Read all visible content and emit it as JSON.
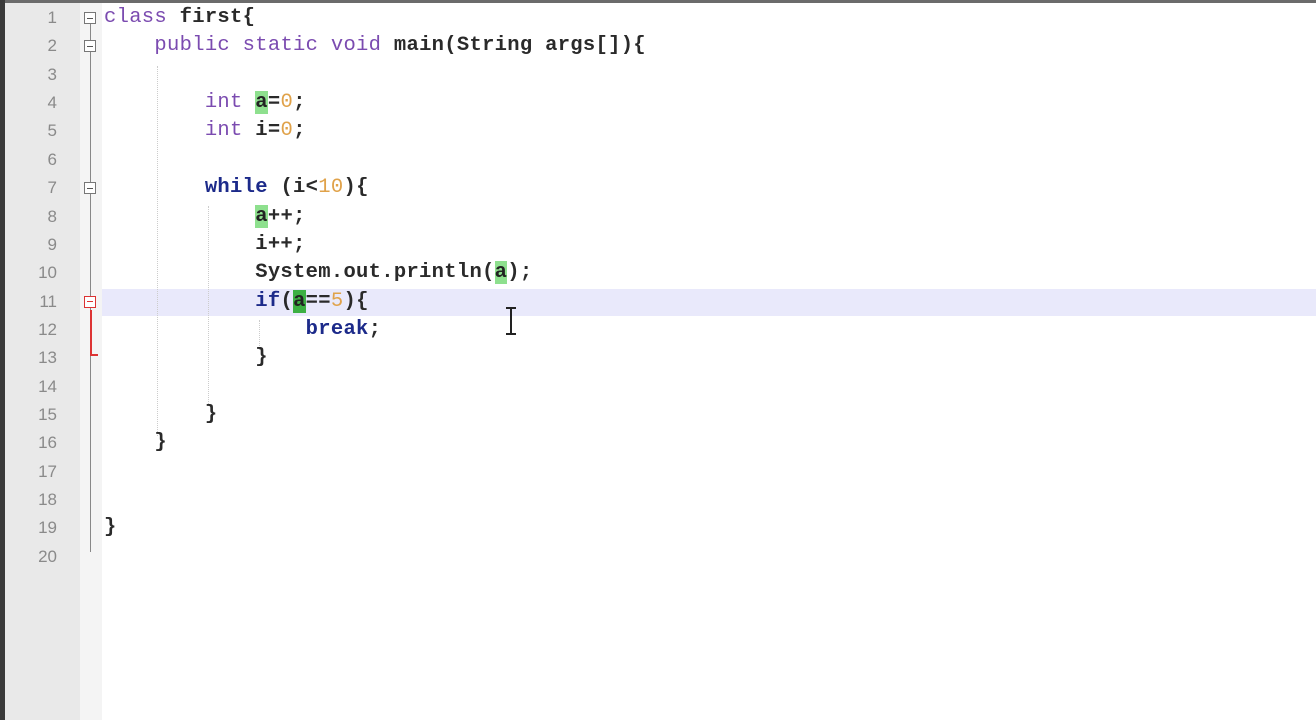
{
  "editor": {
    "current_line": 11,
    "lines": [
      {
        "n": "1",
        "tokens": [
          [
            "kw",
            "class"
          ],
          [
            "plain",
            " first{"
          ]
        ],
        "fold": "open"
      },
      {
        "n": "2",
        "tokens": [
          [
            "plain",
            "    "
          ],
          [
            "kw",
            "public static void"
          ],
          [
            "plain",
            " main(String args[]){"
          ]
        ],
        "fold": "open"
      },
      {
        "n": "3",
        "tokens": []
      },
      {
        "n": "4",
        "tokens": [
          [
            "plain",
            "        "
          ],
          [
            "kw",
            "int"
          ],
          [
            "plain",
            " "
          ],
          [
            "hl",
            "a"
          ],
          [
            "plain",
            "="
          ],
          [
            "num",
            "0"
          ],
          [
            "plain",
            ";"
          ]
        ]
      },
      {
        "n": "5",
        "tokens": [
          [
            "plain",
            "        "
          ],
          [
            "kw",
            "int"
          ],
          [
            "plain",
            " i="
          ],
          [
            "num",
            "0"
          ],
          [
            "plain",
            ";"
          ]
        ]
      },
      {
        "n": "6",
        "tokens": []
      },
      {
        "n": "7",
        "tokens": [
          [
            "plain",
            "        "
          ],
          [
            "ctl",
            "while"
          ],
          [
            "plain",
            " (i<"
          ],
          [
            "num",
            "10"
          ],
          [
            "plain",
            "){"
          ]
        ],
        "fold": "open"
      },
      {
        "n": "8",
        "tokens": [
          [
            "plain",
            "            "
          ],
          [
            "hl",
            "a"
          ],
          [
            "plain",
            "++;"
          ]
        ]
      },
      {
        "n": "9",
        "tokens": [
          [
            "plain",
            "            i++;"
          ]
        ]
      },
      {
        "n": "10",
        "tokens": [
          [
            "plain",
            "            System.out.println("
          ],
          [
            "hl",
            "a"
          ],
          [
            "plain",
            ");"
          ]
        ]
      },
      {
        "n": "11",
        "tokens": [
          [
            "plain",
            "            "
          ],
          [
            "ctl",
            "if"
          ],
          [
            "plain",
            "("
          ],
          [
            "hl2",
            "a"
          ],
          [
            "plain",
            "=="
          ],
          [
            "num",
            "5"
          ],
          [
            "plain",
            "){"
          ]
        ],
        "fold": "red"
      },
      {
        "n": "12",
        "tokens": [
          [
            "plain",
            "                "
          ],
          [
            "ctl",
            "break"
          ],
          [
            "plain",
            ";"
          ]
        ]
      },
      {
        "n": "13",
        "tokens": [
          [
            "plain",
            "            }"
          ]
        ]
      },
      {
        "n": "14",
        "tokens": []
      },
      {
        "n": "15",
        "tokens": [
          [
            "plain",
            "        }"
          ]
        ]
      },
      {
        "n": "16",
        "tokens": [
          [
            "plain",
            "    }"
          ]
        ]
      },
      {
        "n": "17",
        "tokens": []
      },
      {
        "n": "18",
        "tokens": []
      },
      {
        "n": "19",
        "tokens": [
          [
            "plain",
            "}"
          ]
        ]
      },
      {
        "n": "20",
        "tokens": []
      }
    ]
  }
}
